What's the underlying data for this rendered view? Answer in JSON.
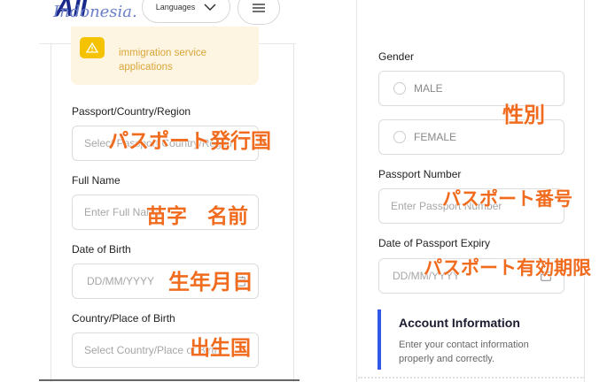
{
  "header": {
    "logo": "All",
    "logo_sub": "Indonesia.",
    "language_label": "Languages"
  },
  "notice": {
    "line1": "immigration service",
    "line2": "applications"
  },
  "left_form": {
    "passport_country": {
      "label": "Passport/Country/Region",
      "placeholder": "Select Passport Country/Region"
    },
    "full_name": {
      "label": "Full Name",
      "placeholder": "Enter Full Name"
    },
    "dob": {
      "label": "Date of Birth",
      "placeholder": "DD/MM/YYYY"
    },
    "birth_country": {
      "label": "Country/Place of Birth",
      "placeholder": "Select Country/Place of Birth"
    }
  },
  "right_form": {
    "gender": {
      "label": "Gender",
      "options": [
        "MALE",
        "FEMALE"
      ]
    },
    "passport_number": {
      "label": "Passport Number",
      "placeholder": "Enter Passport Number"
    },
    "passport_expiry": {
      "label": "Date of Passport Expiry",
      "placeholder": "DD/MM/YYYY"
    }
  },
  "account_info": {
    "title": "Account Information",
    "desc": "Enter your contact information properly and correctly."
  },
  "annotations": {
    "passport_country": "パスポート発行国",
    "full_name": "苗字　名前",
    "dob": "生年月日",
    "birth_country": "出生国",
    "gender": "性別",
    "passport_number": "パスポート番号",
    "passport_expiry": "パスポート有効期限"
  },
  "colors": {
    "annotation": "#f06b1e",
    "brand_blue": "#1a2a8c",
    "accent_bar": "#3157e6",
    "notice_bg": "#fdf5e1",
    "warning_yellow": "#f5c200"
  }
}
